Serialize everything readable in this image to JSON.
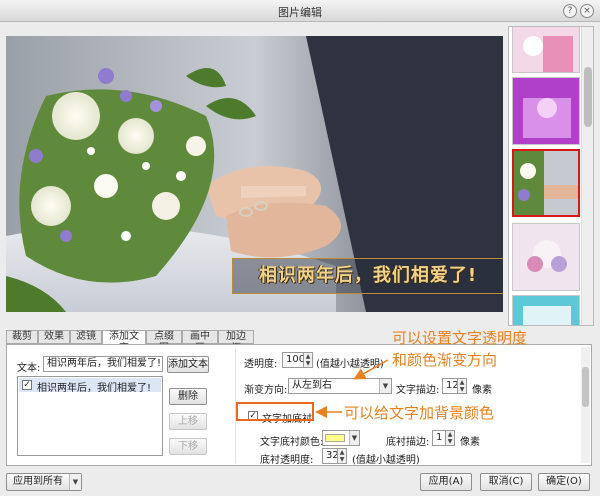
{
  "window": {
    "title": "图片编辑",
    "help_glyph": "?",
    "close_glyph": "×"
  },
  "preview": {
    "overlay_text": "相识两年后，我们相爱了!"
  },
  "tabs": [
    {
      "label": "裁剪",
      "active": false
    },
    {
      "label": "效果",
      "active": false
    },
    {
      "label": "滤镜",
      "active": false
    },
    {
      "label": "添加文字",
      "active": true
    },
    {
      "label": "点缀图",
      "active": false
    },
    {
      "label": "画中画",
      "active": false
    },
    {
      "label": "加边框",
      "active": false
    }
  ],
  "text_panel": {
    "text_label": "文本:",
    "text_value": "相识两年后，我们相爱了!",
    "add_button": "添加文本",
    "list_items": [
      "相识两年后，我们相爱了!"
    ],
    "delete_button": "删除",
    "up_button": "上移",
    "down_button": "下移"
  },
  "settings": {
    "opacity_label": "透明度:",
    "opacity_value": "100",
    "opacity_hint": "(值越小越透明)",
    "gradient_label": "渐变方向:",
    "gradient_value": "从左到右",
    "stroke_label": "文字描边:",
    "stroke_value": "12",
    "stroke_unit": "像素",
    "background_checkbox_label": "文字加底衬",
    "background_checked": true,
    "bg_color_label": "文字底衬颜色:",
    "bg_color": "#ffff8a",
    "bg_stroke_label": "底衬描边:",
    "bg_stroke_value": "1",
    "bg_stroke_unit": "像素",
    "bg_opacity_label": "底衬透明度:",
    "bg_opacity_value": "32",
    "bg_opacity_hint": "(值越小越透明)"
  },
  "annotations": {
    "note1_line1": "可以设置文字透明度",
    "note1_line2": "和颜色渐变方向",
    "note2": "可以给文字加背景颜色"
  },
  "bottom": {
    "apply_all": "应用到所有",
    "apply": "应用(A)",
    "cancel": "取消(C)",
    "ok": "确定(O)"
  },
  "colors": {
    "annotation": "#e8811e",
    "selected_thumb_border": "#d81818",
    "overlay_text": "#f1d28a"
  }
}
